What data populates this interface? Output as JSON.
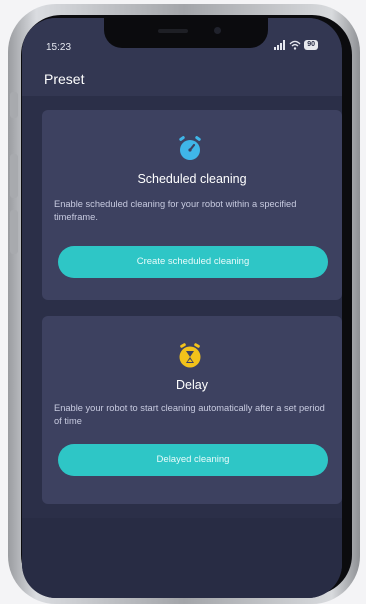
{
  "status_bar": {
    "time": "15:23",
    "battery": "90"
  },
  "header": {
    "title": "Preset"
  },
  "cards": [
    {
      "icon": "alarm-clock-icon",
      "title": "Scheduled cleaning",
      "description": "Enable scheduled cleaning for your robot within a specified timeframe.",
      "button_label": "Create scheduled cleaning"
    },
    {
      "icon": "hourglass-timer-icon",
      "title": "Delay",
      "description": "Enable your robot to start cleaning automatically after a set period of time",
      "button_label": "Delayed cleaning"
    }
  ],
  "colors": {
    "background": "#2b2f48",
    "card": "#3d4160",
    "accent": "#2ec6c6",
    "scheduled_icon": "#3fb6e8",
    "delay_icon": "#f2c21b"
  }
}
